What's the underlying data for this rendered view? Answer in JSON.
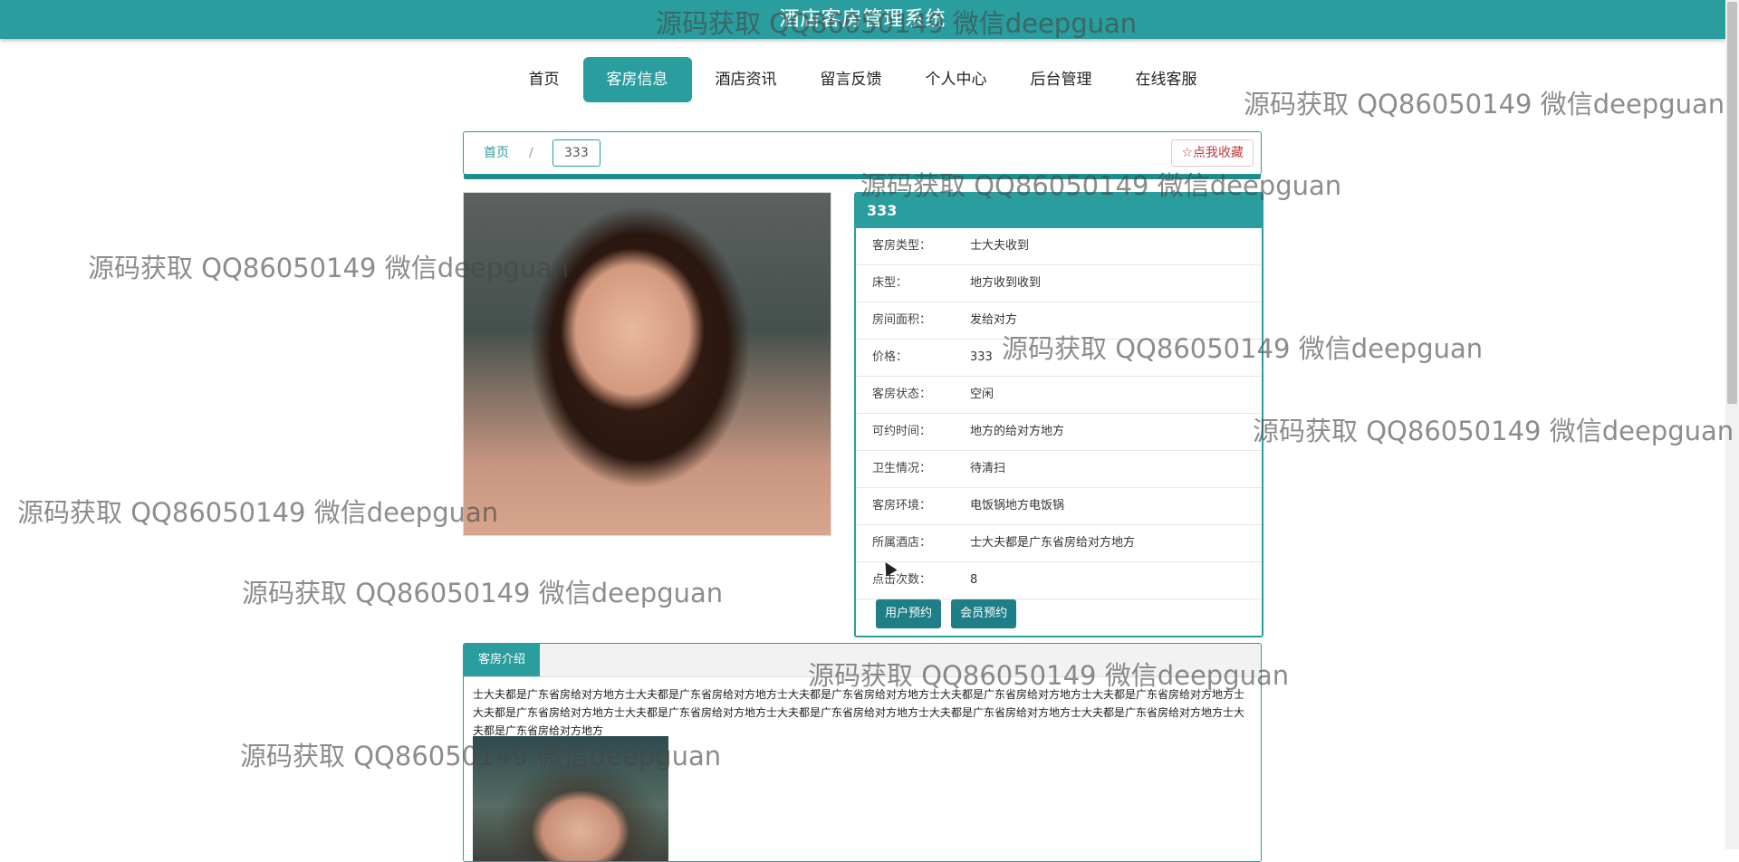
{
  "app": {
    "title": "酒店客房管理系统"
  },
  "nav": {
    "items": [
      {
        "label": "首页",
        "active": false
      },
      {
        "label": "客房信息",
        "active": true
      },
      {
        "label": "酒店资讯",
        "active": false
      },
      {
        "label": "留言反馈",
        "active": false
      },
      {
        "label": "个人中心",
        "active": false
      },
      {
        "label": "后台管理",
        "active": false
      },
      {
        "label": "在线客服",
        "active": false
      }
    ]
  },
  "breadcrumb": {
    "home": "首页",
    "separator": "/",
    "current": "333"
  },
  "favorite": {
    "label": "☆点我收藏"
  },
  "room": {
    "title": "333",
    "fields": [
      {
        "label": "客房类型：",
        "value": "士大夫收到"
      },
      {
        "label": "床型：",
        "value": "地方收到收到"
      },
      {
        "label": "房间面积：",
        "value": "发给对方"
      },
      {
        "label": "价格：",
        "value": "333"
      },
      {
        "label": "客房状态：",
        "value": "空闲"
      },
      {
        "label": "可约时间：",
        "value": "地方的给对方地方"
      },
      {
        "label": "卫生情况：",
        "value": "待清扫"
      },
      {
        "label": "客房环境：",
        "value": "电饭锅地方电饭锅"
      },
      {
        "label": "所属酒店：",
        "value": "士大夫都是广东省房给对方地方"
      },
      {
        "label": "点击次数：",
        "value": "8"
      }
    ],
    "buttons": {
      "user_book": "用户预约",
      "member_book": "会员预约"
    }
  },
  "intro": {
    "tab": "客房介绍",
    "text": "士大夫都是广东省房给对方地方士大夫都是广东省房给对方地方士大夫都是广东省房给对方地方士大夫都是广东省房给对方地方士大夫都是广东省房给对方地方士大夫都是广东省房给对方地方士大夫都是广东省房给对方地方士大夫都是广东省房给对方地方士大夫都是广东省房给对方地方士大夫都是广东省房给对方地方士大夫都是广东省房给对方地方"
  },
  "watermark": {
    "text": "源码获取 QQ86050149 微信deepguan"
  },
  "colors": {
    "accent": "#2a9d9e",
    "button": "#1f7f86",
    "favorite": "#c43a3a"
  }
}
